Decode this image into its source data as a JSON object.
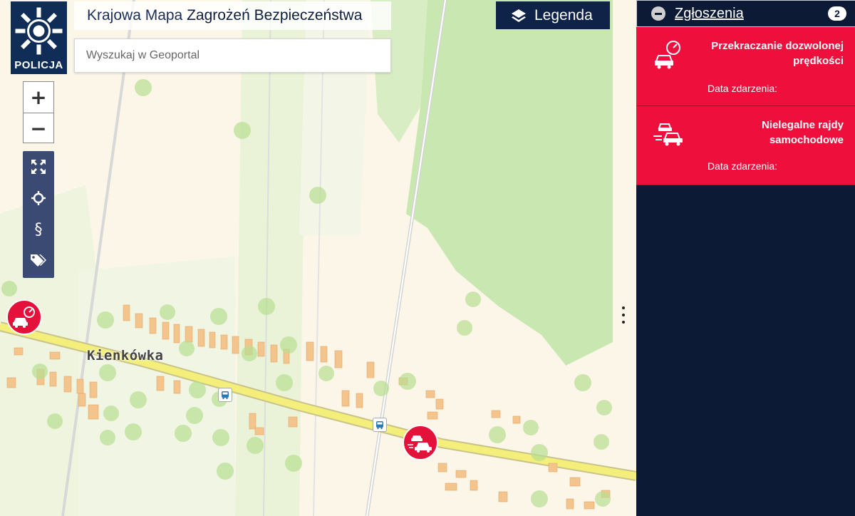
{
  "header": {
    "logo_text": "POLICJA",
    "title_part1": "Krajowa Mapa",
    "title_part2": "Zagrożeń Bezpieczeństwa"
  },
  "search": {
    "placeholder": "Wyszukaj w Geoportal",
    "value": ""
  },
  "zoom": {
    "in_label": "+",
    "out_label": "−"
  },
  "legend_button": {
    "label": "Legenda"
  },
  "map": {
    "place_label": "Kienkówka"
  },
  "panel": {
    "title": "Zgłoszenia",
    "count": "2",
    "reports": [
      {
        "title": "Przekraczanie dozwolonej prędkości",
        "date_label": "Data zdarzenia:",
        "icon": "speeding-car-icon"
      },
      {
        "title": "Nielegalne rajdy samochodowe",
        "date_label": "Data zdarzenia:",
        "icon": "car-racing-icon"
      }
    ]
  },
  "colors": {
    "navy": "#0c1a36",
    "report_red": "#ee0f3c",
    "map_background": "#fbf6e7",
    "forest": "#c9e7b0",
    "road_yellow": "#f3ef7a"
  }
}
